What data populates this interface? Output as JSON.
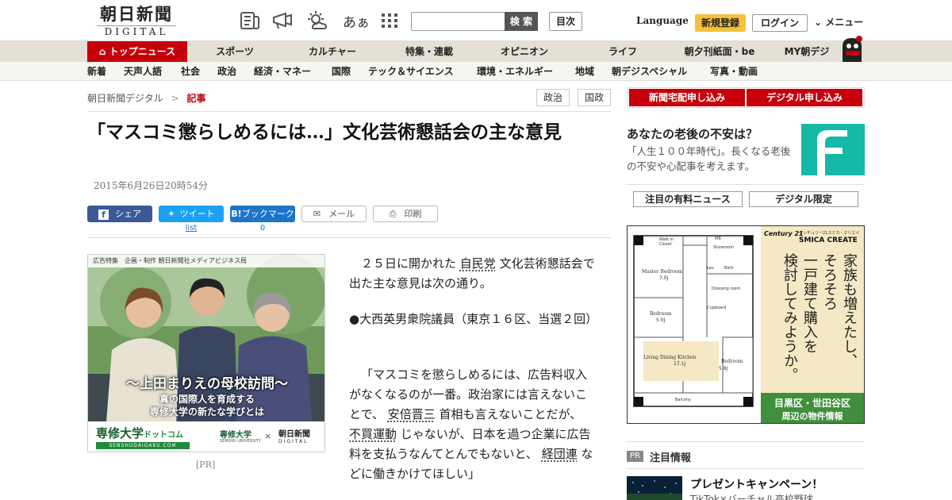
{
  "header": {
    "logo_line1": "朝日新聞",
    "logo_line2": "DIGITAL",
    "search_button": "検 索",
    "search_placeholder": "",
    "mokuji": "目次",
    "language": "Language",
    "register": "新規登録",
    "login": "ログイン",
    "menu": "メニュー",
    "font_size_label": "あぁ"
  },
  "nav_primary": [
    {
      "label": "トップニュース"
    },
    {
      "label": "スポーツ"
    },
    {
      "label": "カルチャー"
    },
    {
      "label": "特集・連載"
    },
    {
      "label": "オピニオン"
    },
    {
      "label": "ライフ"
    },
    {
      "label": "朝夕刊紙面・be"
    },
    {
      "label": "MY朝デジ"
    }
  ],
  "nav_secondary": [
    {
      "label": "新着"
    },
    {
      "label": "天声人語"
    },
    {
      "label": "社会"
    },
    {
      "label": "政治"
    },
    {
      "label": "経済・マネー"
    },
    {
      "label": "国際"
    },
    {
      "label": "テック＆サイエンス"
    },
    {
      "label": "環境・エネルギー"
    },
    {
      "label": "地域"
    },
    {
      "label": "朝デジスペシャル"
    },
    {
      "label": "写真・動画"
    }
  ],
  "breadcrumb": {
    "home": "朝日新聞デジタル",
    "sep": ">",
    "current": "記事"
  },
  "tags": [
    "政治",
    "国政"
  ],
  "article": {
    "title": "「マスコミ懲らしめるには…」文化芸術懇話会の主な意見",
    "date": "2015年6月26日20時54分",
    "share": {
      "facebook": "シェア",
      "twitter": "ツイート",
      "hatena": "ブックマーク",
      "hatena_icon": "B!",
      "mail": "メール",
      "print": "印刷",
      "twitter_count": "list",
      "hatena_count": "0"
    },
    "p1_a": "２５日に開かれた",
    "p1_link": "自民党",
    "p1_b": "文化芸術懇話会で出た主な意見は次の通り。",
    "p2": "●大西英男衆院議員（東京１６区、当選２回）",
    "p3_a": "「マスコミを懲らしめるには、広告料収入がなくなるのが一番。政治家には言えないことで、",
    "p3_link1": "安倍晋三",
    "p3_b": "首相も言えないことだが、",
    "p3_link2": "不買運動",
    "p3_c": "じゃないが、日本を過つ企業に広告料を支払うなんてとんでもないと、",
    "p3_link3": "経団連",
    "p3_d": "などに働きかけてほしい」"
  },
  "ad_left": {
    "label": "広告特集　企画・制作 朝日新聞社メディアビジネス局",
    "headline": "〜上田まりえの母校訪問〜",
    "sub1": "真の国際人を育成する",
    "sub2": "専修大学の新たな学びとは",
    "brand": "専修大学",
    "brand_dot": "ドットコム",
    "brand_url": "SENSHUDAIGAKU.COM",
    "partner1": "専修大学",
    "partner1_en": "SENSHU UNIVERSITY",
    "cross": "×",
    "partner2": "朝日新聞",
    "partner2_en": "DIGITAL",
    "pr": "[PR]"
  },
  "sidebar": {
    "subscribe_paper": "新聞宅配申し込み",
    "subscribe_digital": "デジタル申し込み",
    "promo_title": "あなたの老後の不安は？",
    "promo_text": "「人生１００年時代」。長くなる老後の不安や心配事を考えます。",
    "tab_paid": "注目の有料ニュース",
    "tab_digital": "デジタル限定",
    "ad": {
      "brand_small": "センチュリー21スミカ・クリエイト",
      "brand": "SMICA CREATE",
      "century": "Century 21",
      "copy_lines": [
        "家族も増えたし、",
        "そろそろ",
        "一戸建て購入を",
        "検討してみようか。"
      ],
      "area": "目黒区・世田谷区",
      "area_sub": "周辺の物件情報",
      "rooms": [
        "Master Bedroom",
        "7.0J",
        "Bedroom",
        "5.0J",
        "Living Dining Kitchen",
        "17.1J",
        "Bedroom",
        "5.8J",
        "Walk in Closet",
        "Storeroom",
        "Balcony",
        "Dressing room",
        "Bath",
        "Cupboard",
        "MB",
        "Lav"
      ]
    },
    "pr_badge": "PR",
    "notice_heading": "注目情報",
    "notice_title": "プレゼントキャンペーン！",
    "notice_sub": "TikTok×バーチャル高校野球"
  },
  "colors": {
    "brand_red": "#c7000b",
    "register_yellow": "#f5c23a",
    "facebook": "#3b5998",
    "twitter": "#1da1f2",
    "hatena": "#1d74c9",
    "promo_teal": "#16b8a8",
    "ad_green": "#1f8b3a",
    "ad_area_green": "#3f8f3c",
    "ad_cream": "#f5e8c4"
  },
  "icons": [
    "newspaper-icon",
    "megaphone-icon",
    "weather-icon",
    "font-size-icon",
    "grid-menu-icon",
    "home-icon",
    "chevron-down-icon",
    "facebook-icon",
    "twitter-icon",
    "mail-icon",
    "print-icon",
    "mascot-icon"
  ]
}
